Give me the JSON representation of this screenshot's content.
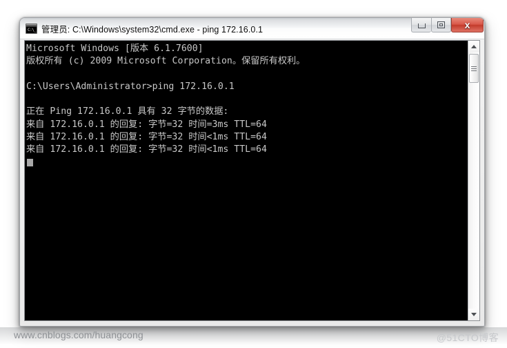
{
  "window": {
    "title": "管理员: C:\\Windows\\system32\\cmd.exe - ping  172.16.0.1",
    "icon": "cmd-console-icon",
    "icon_prompt": "C:\\_",
    "controls": {
      "minimize_label": "—",
      "maximize_label": "❐",
      "close_label": "x",
      "minimize_name": "minimize",
      "maximize_name": "restore",
      "close_name": "close"
    },
    "colors": {
      "close_button": "#d9584a",
      "frame": "#e9e9e9",
      "console_background": "#000000",
      "console_text": "#c8c8c8"
    }
  },
  "console": {
    "lines": [
      "Microsoft Windows [版本 6.1.7600]",
      "版权所有 (c) 2009 Microsoft Corporation。保留所有权利。",
      "",
      "C:\\Users\\Administrator>ping 172.16.0.1",
      "",
      "正在 Ping 172.16.0.1 具有 32 字节的数据:",
      "来自 172.16.0.1 的回复: 字节=32 时间=3ms TTL=64",
      "来自 172.16.0.1 的回复: 字节=32 时间<1ms TTL=64",
      "来自 172.16.0.1 的回复: 字节=32 时间<1ms TTL=64"
    ],
    "cursor": "block-cursor"
  },
  "scrollbar": {
    "up_arrow": "scroll-up-arrow",
    "down_arrow": "scroll-down-arrow",
    "thumb": "scroll-thumb"
  },
  "watermarks": {
    "left": "www.cnblogs.com/huangcong",
    "right": "@51CTO博客"
  }
}
